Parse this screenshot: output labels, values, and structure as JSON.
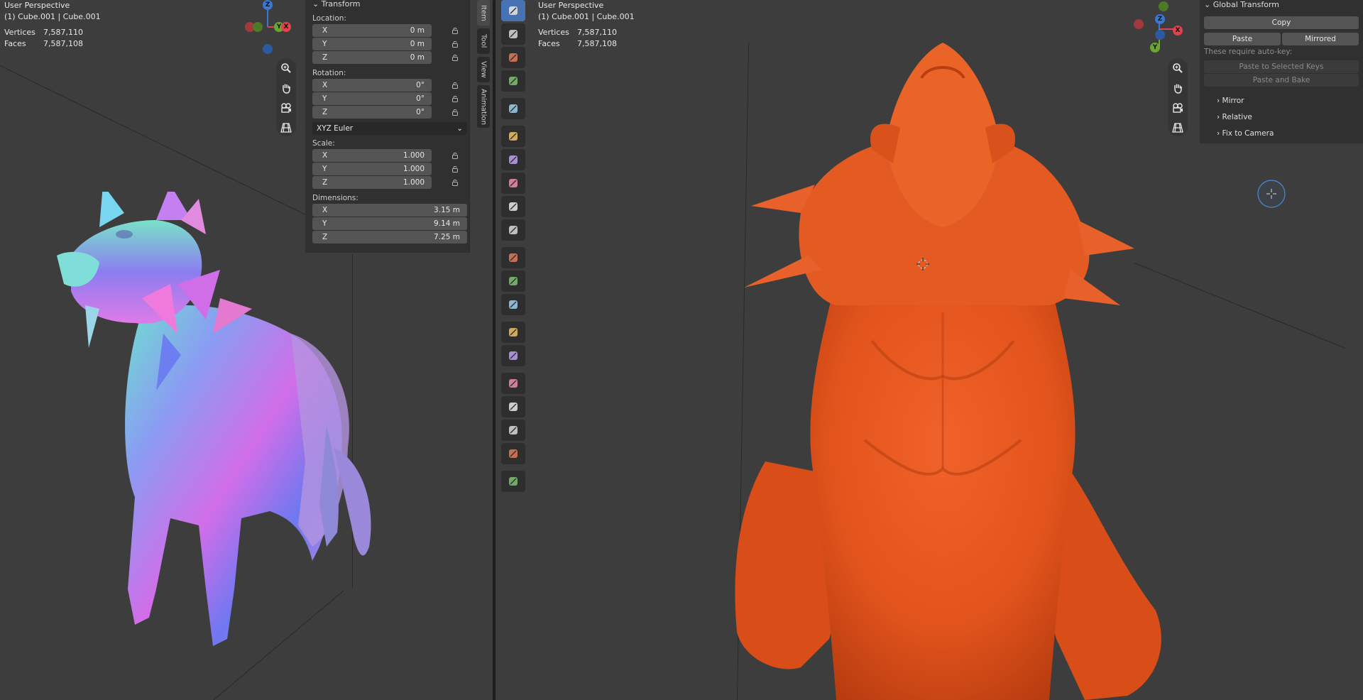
{
  "left_viewport": {
    "perspective": "User Perspective",
    "object": "(1) Cube.001 | Cube.001",
    "vertices_label": "Vertices",
    "vertices_value": "7,587,110",
    "faces_label": "Faces",
    "faces_value": "7,587,108"
  },
  "right_viewport": {
    "perspective": "User Perspective",
    "object": "(1) Cube.001 | Cube.001",
    "vertices_label": "Vertices",
    "vertices_value": "7,587,110",
    "faces_label": "Faces",
    "faces_value": "7,587,108"
  },
  "gizmo": {
    "z": "Z",
    "y": "Y",
    "x": "X"
  },
  "transform_panel": {
    "title": "Transform",
    "location_label": "Location:",
    "location": [
      {
        "axis": "X",
        "value": "0 m"
      },
      {
        "axis": "Y",
        "value": "0 m"
      },
      {
        "axis": "Z",
        "value": "0 m"
      }
    ],
    "rotation_label": "Rotation:",
    "rotation": [
      {
        "axis": "X",
        "value": "0°"
      },
      {
        "axis": "Y",
        "value": "0°"
      },
      {
        "axis": "Z",
        "value": "0°"
      }
    ],
    "rotation_mode": "XYZ Euler",
    "scale_label": "Scale:",
    "scale": [
      {
        "axis": "X",
        "value": "1.000"
      },
      {
        "axis": "Y",
        "value": "1.000"
      },
      {
        "axis": "Z",
        "value": "1.000"
      }
    ],
    "dimensions_label": "Dimensions:",
    "dimensions": [
      {
        "axis": "X",
        "value": "3.15 m"
      },
      {
        "axis": "Y",
        "value": "9.14 m"
      },
      {
        "axis": "Z",
        "value": "7.25 m"
      }
    ]
  },
  "sidebar_tabs": [
    "Item",
    "Tool",
    "View",
    "Animation"
  ],
  "global_transform": {
    "title": "Global Transform",
    "copy": "Copy",
    "paste": "Paste",
    "mirrored": "Mirrored",
    "note": "These require auto-key:",
    "paste_selected": "Paste to Selected Keys",
    "paste_bake": "Paste and Bake",
    "mirror": "Mirror",
    "relative": "Relative",
    "fix_camera": "Fix to Camera"
  },
  "colors": {
    "accent": "#4772b3",
    "viewport_bg": "#3d3d3d",
    "panel_bg": "#303030",
    "field_bg": "#545454",
    "axis_x": "#e0424e",
    "axis_y": "#6aa72e",
    "axis_z": "#3a78d6",
    "model_orange": "#e2541c"
  },
  "icons": [
    "zoom-icon",
    "hand-pan-icon",
    "camera-icon",
    "grid-ortho-icon",
    "lock-icon",
    "chevron-down-icon"
  ]
}
